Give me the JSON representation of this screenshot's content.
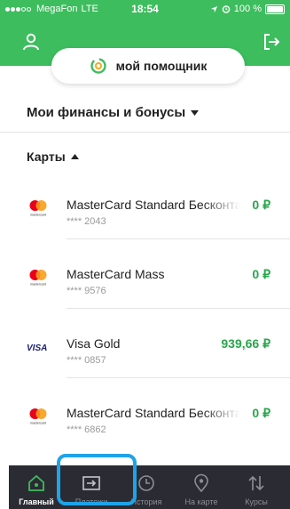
{
  "status_bar": {
    "carrier": "MegaFon",
    "network": "LTE",
    "time": "18:54",
    "battery": "100 %"
  },
  "header": {
    "assistant_label": "мой помощник"
  },
  "finances": {
    "title": "Мои финансы и бонусы"
  },
  "cards": {
    "title": "Карты",
    "items": [
      {
        "brand_icon": "mastercard-icon",
        "name": "MasterCard Standard Бесконтактная",
        "number": "**** 2043",
        "balance": "0 ₽"
      },
      {
        "brand_icon": "mastercard-icon",
        "name": "MasterCard Mass",
        "number": "**** 9576",
        "balance": "0 ₽"
      },
      {
        "brand_icon": "visa-icon",
        "name": "Visa Gold",
        "number": "**** 0857",
        "balance": "939,66 ₽"
      },
      {
        "brand_icon": "mastercard-icon",
        "name": "MasterCard Standard Бесконтактная",
        "number": "**** 6862",
        "balance": "0 ₽"
      }
    ],
    "visa_text": "VISA",
    "mastercard_text": "mastercard"
  },
  "tabs": [
    {
      "label": "Главный",
      "icon": "home-icon",
      "active": true
    },
    {
      "label": "Платежи",
      "icon": "payments-icon",
      "active": false
    },
    {
      "label": "История",
      "icon": "history-icon",
      "active": false
    },
    {
      "label": "На карте",
      "icon": "map-pin-icon",
      "active": false
    },
    {
      "label": "Курсы",
      "icon": "exchange-arrows-icon",
      "active": false
    }
  ],
  "colors": {
    "brand_green": "#3dbd5e",
    "balance_green": "#27a74a",
    "tabbar": "#2b2b33",
    "highlight": "#1fa3e8"
  }
}
